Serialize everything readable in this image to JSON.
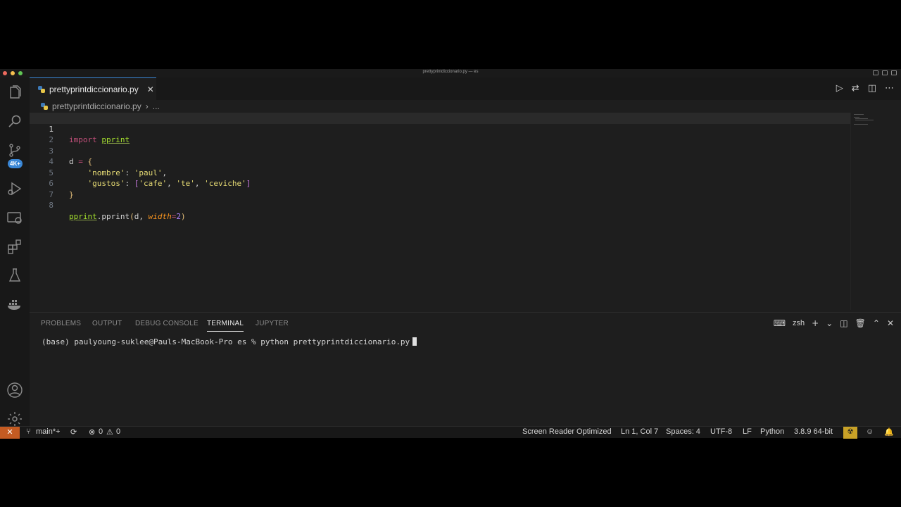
{
  "window": {
    "title": "prettyprintdiccionario.py — es"
  },
  "activity_bar": {
    "icons": [
      "explorer-icon",
      "search-icon",
      "source-control-icon",
      "run-debug-icon",
      "remote-explorer-icon",
      "extensions-icon",
      "testing-icon",
      "docker-icon",
      "account-icon",
      "settings-gear-icon"
    ],
    "badge": "4K+"
  },
  "tab": {
    "label": "prettyprintdiccionario.py",
    "close": "✕"
  },
  "breadcrumb": {
    "file": "prettyprintdiccionario.py",
    "more": "..."
  },
  "editor": {
    "line_numbers": [
      "1",
      "2",
      "3",
      "4",
      "5",
      "6",
      "7",
      "8"
    ],
    "code": {
      "l1_kw": "import",
      "l1_mod": "pprint",
      "l3_var": "d",
      "l3_op": "=",
      "l3_brace": "{",
      "l4_key": "'nombre'",
      "l4_val": "'paul'",
      "l5_key": "'gustos'",
      "l5_items": [
        "'cafe'",
        "'te'",
        "'ceviche'"
      ],
      "l6_brace": "}",
      "l8_mod": "pprint",
      "l8_fn": "pprint",
      "l8_arg": "d",
      "l8_param": "width",
      "l8_val": "2"
    }
  },
  "panel": {
    "tabs": [
      "PROBLEMS",
      "OUTPUT",
      "DEBUG CONSOLE",
      "TERMINAL",
      "JUPYTER"
    ],
    "active_tab": "TERMINAL",
    "shell": "zsh",
    "terminal_prompt": "(base) paulyoung-suklee@Pauls-MacBook-Pro es % python prettyprintdiccionario.py"
  },
  "status_bar": {
    "remote": "✕",
    "branch": "main*+",
    "errors": "0",
    "warnings": "0",
    "screen_reader": "Screen Reader Optimized",
    "position": "Ln 1, Col 7",
    "spaces": "Spaces: 4",
    "encoding": "UTF-8",
    "eol": "LF",
    "language": "Python",
    "interpreter": "3.8.9 64-bit"
  },
  "colors": {
    "accent": "#3a87d6",
    "remote": "#c45b22",
    "keyword": "#c24f7a",
    "module": "#a6e22e",
    "string": "#e6db74"
  }
}
